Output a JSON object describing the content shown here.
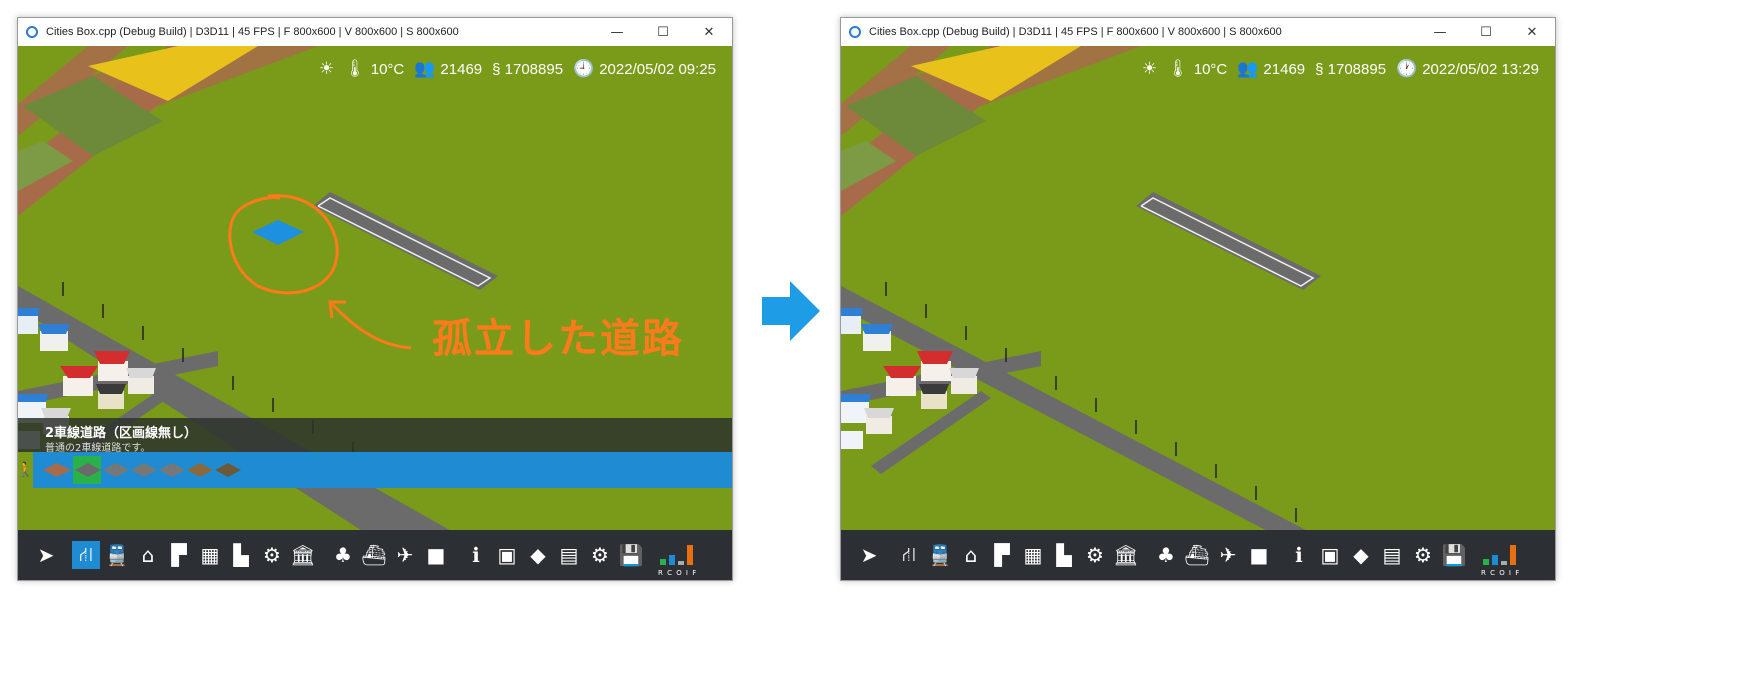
{
  "left_window": {
    "title": "Cities Box.cpp (Debug Build) | D3D11 | 45 FPS | F 800x600 | V 800x600 | S 800x600",
    "hud": {
      "weather_icon": "sun-icon",
      "temperature": "10°C",
      "population": "21469",
      "money": "§ 1708895",
      "datetime": "2022/05/02 09:25"
    },
    "info_panel": {
      "title": "2車線道路（区画線無し）",
      "description": "普通の2車線道路です。"
    },
    "annotation": "孤立した道路"
  },
  "right_window": {
    "title": "Cities Box.cpp (Debug Build) | D3D11 | 45 FPS | F 800x600 | V 800x600 | S 800x600",
    "hud": {
      "weather_icon": "sun-icon",
      "temperature": "10°C",
      "population": "21469",
      "money": "§ 1708895",
      "datetime": "2022/05/02 13:29"
    }
  },
  "window_buttons": {
    "minimize": "—",
    "maximize": "☐",
    "close": "✕"
  },
  "rcoi_label": "R C O I F",
  "colors": {
    "ground": "#7a9a1a",
    "toolbar": "#2c2f33",
    "accent_blue": "#1f8bd2",
    "annotation_orange": "#ff7a1a",
    "road": "#6b6b6b"
  },
  "toolbar_icons": [
    "cursor-icon",
    "road-icon",
    "train-icon",
    "house-icon",
    "shop-icon",
    "office-icon",
    "factory-icon",
    "tractor-icon",
    "public-building-icon",
    "tree-icon",
    "ship-icon",
    "airplane-icon",
    "blank-tile-icon",
    "info-icon",
    "grid-view-icon",
    "eraser-icon",
    "finance-icon",
    "settings-icon",
    "save-icon"
  ]
}
